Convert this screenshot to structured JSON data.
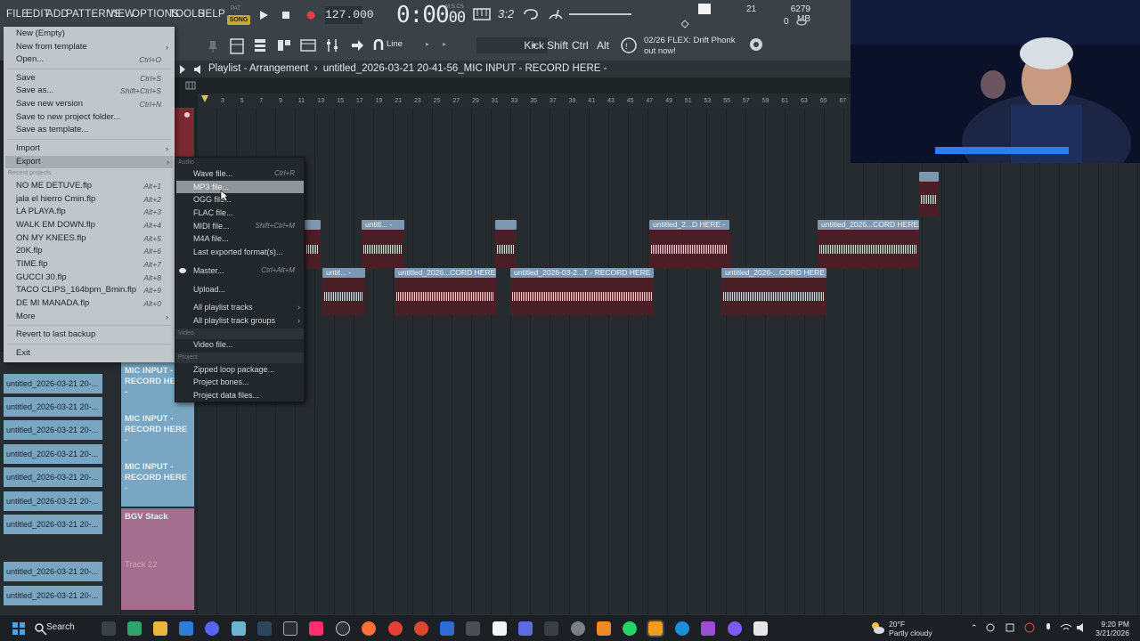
{
  "menubar": {
    "items": [
      "FILE",
      "EDIT",
      "ADD",
      "PATTERNS",
      "VIEW",
      "OPTIONS",
      "TOOLS",
      "HELP"
    ]
  },
  "transport": {
    "mode_pat": "PAT",
    "mode_song": "SONG",
    "tempo": "127.000",
    "time": "0:00",
    "time_fraction": "00",
    "time_unit": "M:S:CS",
    "cpu": "21",
    "memory": "6279 MB",
    "voices": "0"
  },
  "toolbar": {
    "snap": "Line",
    "instrument": "Kick",
    "shift": "Shift",
    "ctrl": "Ctrl",
    "alt": "Alt",
    "news_counter": "02/26",
    "news_text": "FLEX: Drift Phonk out now!"
  },
  "playlist": {
    "title": "Playlist - Arrangement",
    "project": "untitled_2026-03-21 20-41-56_MIC INPUT - RECORD HERE -",
    "ruler": [
      "3",
      "5",
      "7",
      "9",
      "11",
      "13",
      "15",
      "17",
      "19",
      "21",
      "23",
      "25",
      "27",
      "29",
      "31",
      "33",
      "35",
      "37",
      "39",
      "41",
      "43",
      "45",
      "47",
      "49",
      "51",
      "53",
      "55",
      "57",
      "59",
      "61",
      "63",
      "65",
      "67"
    ]
  },
  "clips": {
    "row1": [
      "",
      "untitl... -",
      "",
      "untitled_2...D HERE -",
      "untitled_2026...CORD HERE -"
    ],
    "row2": [
      "untit... -",
      "untitled_2026...CORD HERE -",
      "untitled_2026-03-2...T - RECORD HERE -",
      "untitled_2026-...CORD HERE -"
    ],
    "top_right": ""
  },
  "file_menu": {
    "new_empty": "New (Empty)",
    "new_template": "New from template",
    "open": "Open...",
    "open_sc": "Ctrl+O",
    "save": "Save",
    "save_sc": "Ctrl+S",
    "save_as": "Save as...",
    "save_as_sc": "Shift+Ctrl+S",
    "save_new_version": "Save new version",
    "save_new_version_sc": "Ctrl+N",
    "save_to_folder": "Save to new project folder...",
    "save_template": "Save as template...",
    "import": "Import",
    "export": "Export",
    "recent_caption": "Recent projects",
    "recent": [
      {
        "name": "NO ME DETUVE.flp",
        "sc": "Alt+1"
      },
      {
        "name": "jala el hierro Cmin.flp",
        "sc": "Alt+2"
      },
      {
        "name": "LA PLAYA.flp",
        "sc": "Alt+3"
      },
      {
        "name": "WALK EM DOWN.flp",
        "sc": "Alt+4"
      },
      {
        "name": "ON MY KNEES.flp",
        "sc": "Alt+5"
      },
      {
        "name": "20K.flp",
        "sc": "Alt+6"
      },
      {
        "name": "TIME.flp",
        "sc": "Alt+7"
      },
      {
        "name": "GUCCI 30.flp",
        "sc": "Alt+8"
      },
      {
        "name": "TACO CLIPS_164bpm_Bmin.flp",
        "sc": "Alt+9"
      },
      {
        "name": "DE MI MANADA.flp",
        "sc": "Alt+0"
      }
    ],
    "more": "More",
    "revert": "Revert to last backup",
    "exit": "Exit"
  },
  "export_menu": {
    "audio_caption": "Audio",
    "wave": "Wave file...",
    "wave_sc": "Ctrl+R",
    "mp3": "MP3 file...",
    "mp3_sc": "Shift+Ctrl+R",
    "ogg": "OGG file...",
    "flac": "FLAC file...",
    "midi": "MIDI file...",
    "midi_sc": "Shift+Ctrl+M",
    "m4a": "M4A file...",
    "last_exported": "Last exported format(s)...",
    "master": "Master...",
    "master_sc": "Ctrl+Alt+M",
    "upload": "Upload...",
    "all_tracks": "All playlist tracks",
    "all_groups": "All playlist track groups",
    "video_caption": "Video",
    "video": "Video file...",
    "project_caption": "Project",
    "zipped": "Zipped loop package...",
    "bones": "Project bones...",
    "data_files": "Project data files..."
  },
  "track_list": {
    "items": [
      "untitled_2026-03-21 20-...",
      "untitled_2026-03-21 20-...",
      "untitled_2026-03-21 20-...",
      "untitled_2026-03-21 20-...",
      "untitled_2026-03-21 20-...",
      "untitled_2026-03-21 20-...",
      "untitled_2026-03-21 20-...",
      "untitled_2026-03-21 20-...",
      "untitled_2026-03-21 20-..."
    ]
  },
  "track_headers": {
    "mic1": "MIC INPUT - RECORD HERE -",
    "mic2": "MIC INPUT - RECORD HERE -",
    "mic3": "MIC INPUT - RECORD HERE -",
    "bgv": "BGV Stack",
    "track22": "Track 22"
  },
  "taskbar": {
    "search": "Search",
    "weather_temp": "20°F",
    "weather_desc": "Partly cloudy",
    "time": "9:20 PM",
    "date": "3/21/2026"
  },
  "colors": {
    "accent_clip": "#7b98b2",
    "clip_body": "#4a1e25",
    "menu_bg": "#c0c6ca",
    "submenu_bg": "#21272a"
  }
}
